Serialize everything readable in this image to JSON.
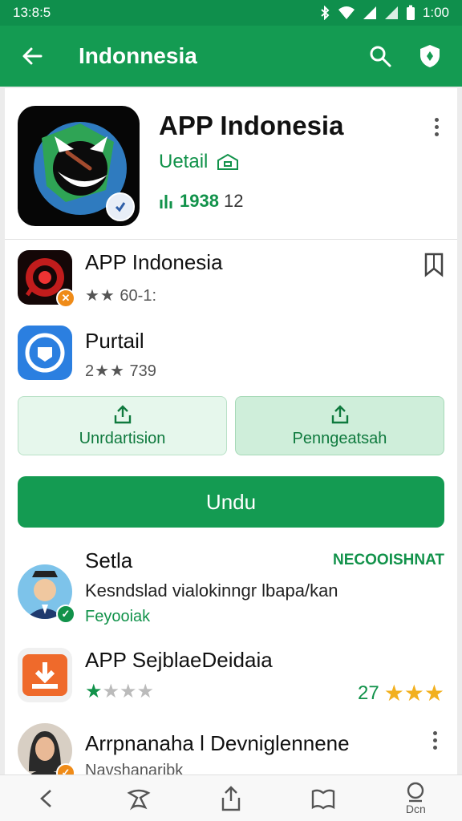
{
  "status_bar": {
    "time": "13:8:5",
    "clock": "1:00"
  },
  "app_bar": {
    "title": "Indonnesia"
  },
  "header": {
    "title": "APP Indonesia",
    "subtitle": "Uetail",
    "downloads": "1938",
    "downloads_suffix": "12"
  },
  "apps": [
    {
      "title": "APP Indonesia",
      "stars_text": "★★",
      "meta": "60-1:"
    },
    {
      "title": "Purtail",
      "stars_text": "2★★",
      "meta": "739"
    }
  ],
  "buttons": {
    "left": "Unrdartision",
    "right": "Penngeatsah",
    "main": "Undu"
  },
  "reviews": [
    {
      "title": "Setla",
      "tag": "NECOOISHNAT",
      "body": "Kesndslad vialokinngr lbapa/kan",
      "sub": "Feyooiak"
    },
    {
      "title": "APP SejblaeDeidaia",
      "stars_filled": "★",
      "stars_empty": "★★★",
      "score": "27",
      "score_stars": "★★★"
    },
    {
      "title": "Arrpnanaha l Devniglennene",
      "sub": "Navshanaribk"
    }
  ],
  "nav": {
    "last_label": "Dcn"
  },
  "colors": {
    "primary": "#149b52",
    "status": "#0f8f4c",
    "star": "#f2b01e"
  }
}
